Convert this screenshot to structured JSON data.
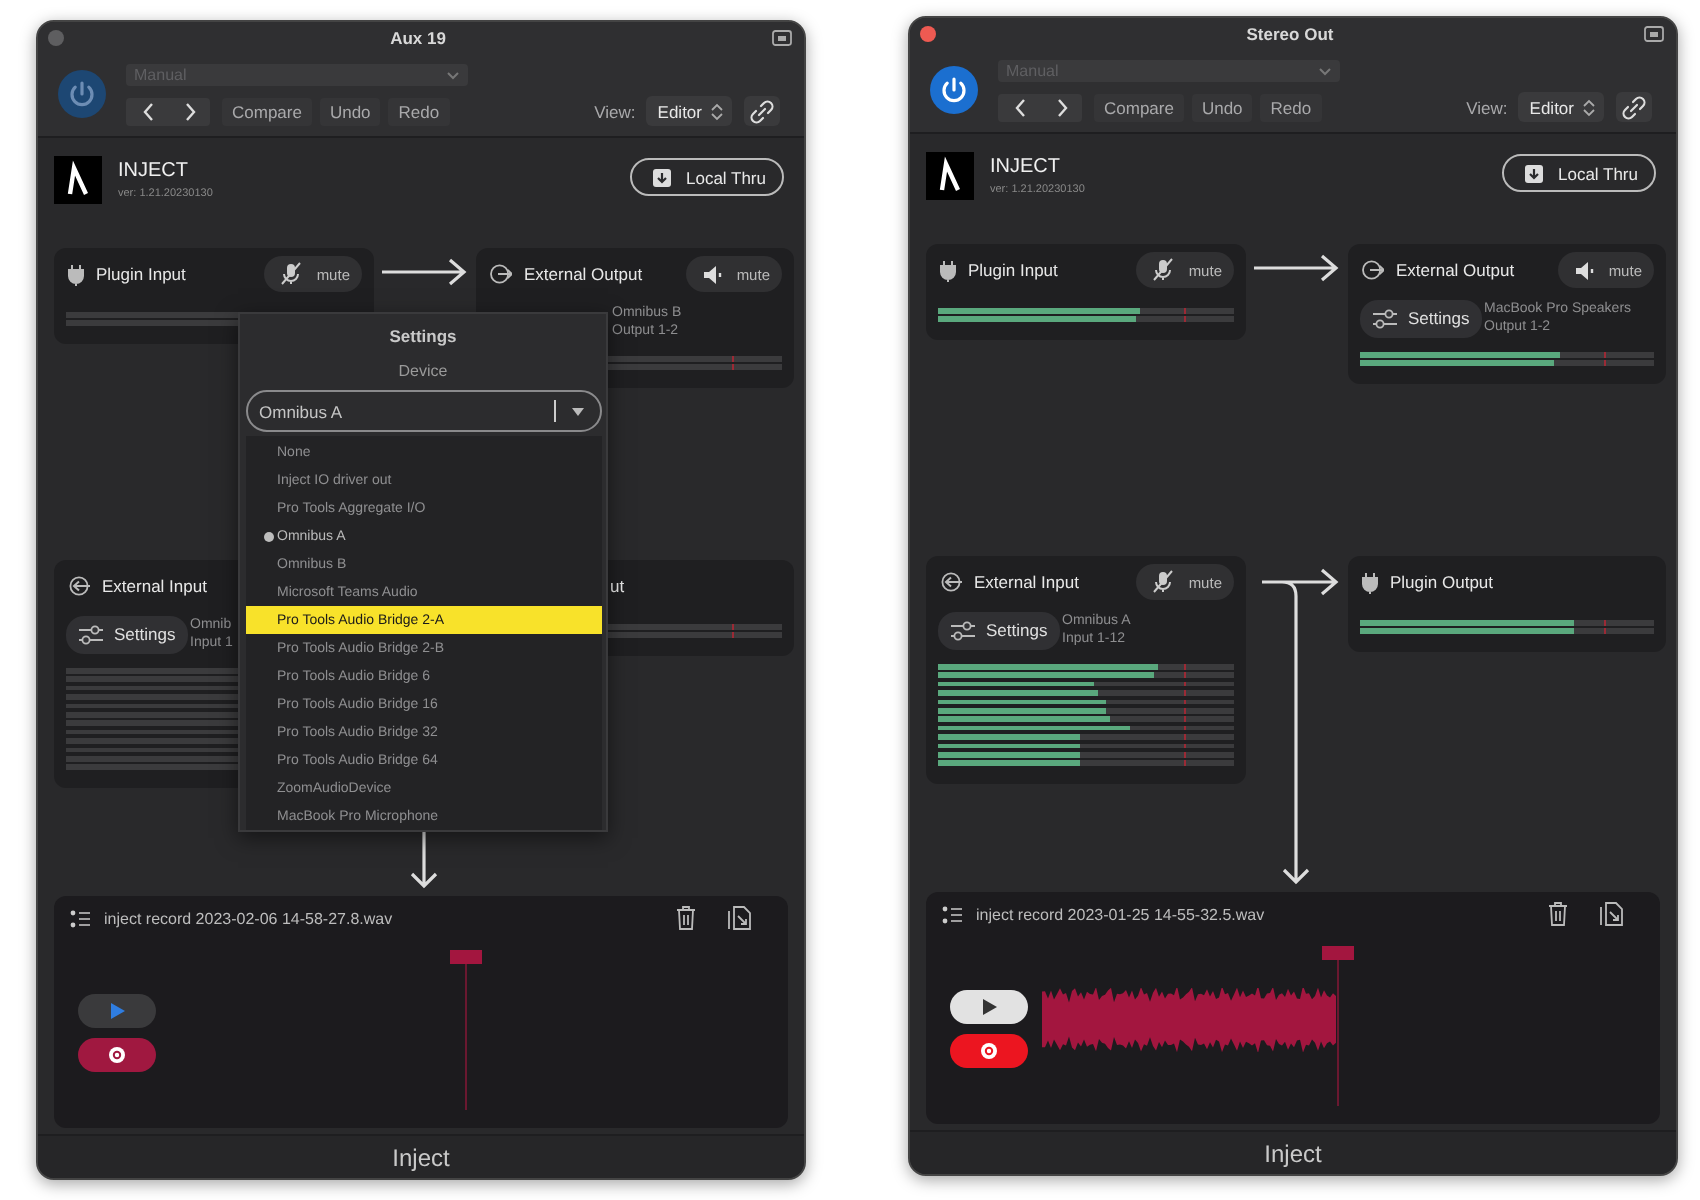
{
  "windows": [
    {
      "title": "Aux 19",
      "active": false,
      "toolbar": {
        "preset": "Manual",
        "buttons": [
          "Compare",
          "Undo",
          "Redo"
        ],
        "view_label": "View:",
        "view_value": "Editor"
      },
      "plugin": {
        "name": "INJECT",
        "version": "ver: 1.21.20230130",
        "local_thru": "Local Thru"
      },
      "nodes": [
        {
          "kind": "plugin_input",
          "title": "Plugin Input",
          "mute": "mute",
          "meters": [
            {
              "level": 0
            },
            {
              "level": 0
            }
          ]
        },
        {
          "kind": "external_output",
          "title": "External Output",
          "mute": "mute",
          "device": [
            "Omnibus B",
            "Output 1-2"
          ],
          "meters": [
            {
              "level": 0
            },
            {
              "level": 0
            }
          ]
        },
        {
          "kind": "external_input",
          "title": "External Input",
          "settings": "Settings",
          "device": [
            "Omnib",
            "Input 1"
          ],
          "meters": [
            {
              "level": 0
            },
            {
              "level": 0
            },
            {
              "level": 0
            },
            {
              "level": 0
            },
            {
              "level": 0
            },
            {
              "level": 0
            },
            {
              "level": 0
            },
            {
              "level": 0
            },
            {
              "level": 0
            },
            {
              "level": 0
            },
            {
              "level": 0
            },
            {
              "level": 0
            }
          ]
        },
        {
          "kind": "plugin_output",
          "title": "ut",
          "clipped": true,
          "meters": [
            {
              "level": 0
            },
            {
              "level": 0
            }
          ]
        }
      ],
      "device_popup": {
        "title": "Settings",
        "label": "Device",
        "value": "Omnibus A",
        "options": [
          {
            "label": "None",
            "selected": false,
            "highlighted": false
          },
          {
            "label": "Inject IO driver out",
            "selected": false,
            "highlighted": false
          },
          {
            "label": "Pro Tools Aggregate I/O",
            "selected": false,
            "highlighted": false
          },
          {
            "label": "Omnibus A",
            "selected": true,
            "highlighted": false
          },
          {
            "label": "Omnibus B",
            "selected": false,
            "highlighted": false
          },
          {
            "label": "Microsoft Teams Audio",
            "selected": false,
            "highlighted": false
          },
          {
            "label": "Pro Tools Audio Bridge 2-A",
            "selected": false,
            "highlighted": true
          },
          {
            "label": "Pro Tools Audio Bridge 2-B",
            "selected": false,
            "highlighted": false
          },
          {
            "label": "Pro Tools Audio Bridge 6",
            "selected": false,
            "highlighted": false
          },
          {
            "label": "Pro Tools Audio Bridge 16",
            "selected": false,
            "highlighted": false
          },
          {
            "label": "Pro Tools Audio Bridge 32",
            "selected": false,
            "highlighted": false
          },
          {
            "label": "Pro Tools Audio Bridge 64",
            "selected": false,
            "highlighted": false
          },
          {
            "label": "ZoomAudioDevice",
            "selected": false,
            "highlighted": false
          },
          {
            "label": "MacBook Pro Microphone",
            "selected": false,
            "highlighted": false
          }
        ]
      },
      "recorder": {
        "file": "inject record 2023-02-06 14-58-27.8.wav",
        "recorded": false
      },
      "footer": "Inject"
    },
    {
      "title": "Stereo Out",
      "active": true,
      "toolbar": {
        "preset": "Manual",
        "buttons": [
          "Compare",
          "Undo",
          "Redo"
        ],
        "view_label": "View:",
        "view_value": "Editor"
      },
      "plugin": {
        "name": "INJECT",
        "version": "ver: 1.21.20230130",
        "local_thru": "Local Thru"
      },
      "nodes": [
        {
          "kind": "plugin_input",
          "title": "Plugin Input",
          "mute": "mute",
          "meters": [
            {
              "level": 0.68
            },
            {
              "level": 0.67
            }
          ]
        },
        {
          "kind": "external_output",
          "title": "External Output",
          "mute": "mute",
          "settings": "Settings",
          "device": [
            "MacBook Pro Speakers",
            "Output 1-2"
          ],
          "meters": [
            {
              "level": 0.68
            },
            {
              "level": 0.66
            }
          ]
        },
        {
          "kind": "external_input",
          "title": "External Input",
          "mute": "mute",
          "settings": "Settings",
          "device": [
            "Omnibus A",
            "Input 1-12"
          ],
          "meters": [
            {
              "level": 0.74
            },
            {
              "level": 0.73
            },
            {
              "level": 0.53
            },
            {
              "level": 0.54
            },
            {
              "level": 0.57
            },
            {
              "level": 0.57
            },
            {
              "level": 0.58
            },
            {
              "level": 0.65
            },
            {
              "level": 0.48
            },
            {
              "level": 0.48
            },
            {
              "level": 0.48
            },
            {
              "level": 0.48
            }
          ]
        },
        {
          "kind": "plugin_output",
          "title": "Plugin Output",
          "meters": [
            {
              "level": 0.73
            },
            {
              "level": 0.73
            }
          ]
        }
      ],
      "recorder": {
        "file": "inject record 2023-01-25 14-55-32.5.wav",
        "recorded": true
      },
      "footer": "Inject"
    }
  ]
}
